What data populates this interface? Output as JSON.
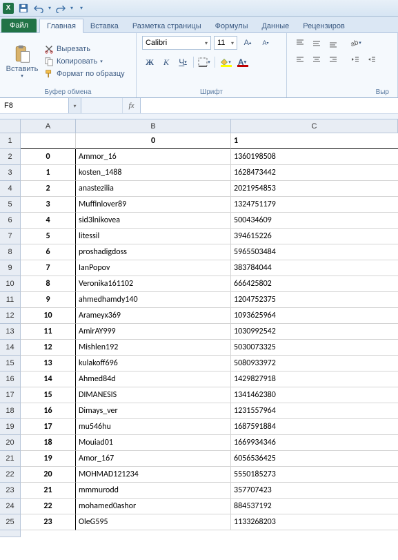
{
  "qat": {
    "save": "save",
    "undo": "undo",
    "redo": "redo"
  },
  "tabs": {
    "file": "Файл",
    "home": "Главная",
    "insert": "Вставка",
    "layout": "Разметка страницы",
    "formulas": "Формулы",
    "data": "Данные",
    "review": "Рецензиров"
  },
  "ribbon": {
    "paste": "Вставить",
    "cut": "Вырезать",
    "copy": "Копировать",
    "fmtpainter": "Формат по образцу",
    "clipboard_label": "Буфер обмена",
    "font_name": "Calibri",
    "font_size": "11",
    "font_label": "Шрифт",
    "align_label": "Выр"
  },
  "namebox": "F8",
  "formula": "",
  "columns": [
    "A",
    "B",
    "C"
  ],
  "header_row": [
    "",
    "0",
    "1"
  ],
  "rows": [
    {
      "n": 1
    },
    {
      "n": 2,
      "a": "0",
      "b": "Ammor_16",
      "c": "1360198508"
    },
    {
      "n": 3,
      "a": "1",
      "b": "kosten_1488",
      "c": "1628473442"
    },
    {
      "n": 4,
      "a": "2",
      "b": "anastezilia",
      "c": "2021954853"
    },
    {
      "n": 5,
      "a": "3",
      "b": "Muffinlover89",
      "c": "1324751179"
    },
    {
      "n": 6,
      "a": "4",
      "b": "sid3lnikovea",
      "c": "500434609"
    },
    {
      "n": 7,
      "a": "5",
      "b": "litessil",
      "c": "394615226"
    },
    {
      "n": 8,
      "a": "6",
      "b": "proshadigdoss",
      "c": "5965503484"
    },
    {
      "n": 9,
      "a": "7",
      "b": "IanPopov",
      "c": "383784044"
    },
    {
      "n": 10,
      "a": "8",
      "b": "Veronika161102",
      "c": "666425802"
    },
    {
      "n": 11,
      "a": "9",
      "b": "ahmedhamdy140",
      "c": "1204752375"
    },
    {
      "n": 12,
      "a": "10",
      "b": "Arameyx369",
      "c": "1093625964"
    },
    {
      "n": 13,
      "a": "11",
      "b": "AmirAY999",
      "c": "1030992542"
    },
    {
      "n": 14,
      "a": "12",
      "b": "Mishlen192",
      "c": "5030073325"
    },
    {
      "n": 15,
      "a": "13",
      "b": "kulakoff696",
      "c": "5080933972"
    },
    {
      "n": 16,
      "a": "14",
      "b": "Ahmed84d",
      "c": "1429827918"
    },
    {
      "n": 17,
      "a": "15",
      "b": "DIMANESIS",
      "c": "1341462380"
    },
    {
      "n": 18,
      "a": "16",
      "b": "Dimays_ver",
      "c": "1231557964"
    },
    {
      "n": 19,
      "a": "17",
      "b": "mu546hu",
      "c": "1687591884"
    },
    {
      "n": 20,
      "a": "18",
      "b": "Mouiad01",
      "c": "1669934346"
    },
    {
      "n": 21,
      "a": "19",
      "b": "Amor_167",
      "c": "6056536425"
    },
    {
      "n": 22,
      "a": "20",
      "b": "MOHMAD121234",
      "c": "5550185273"
    },
    {
      "n": 23,
      "a": "21",
      "b": "mmmurodd",
      "c": "357707423"
    },
    {
      "n": 24,
      "a": "22",
      "b": "mohamed0ashor",
      "c": "884537192"
    },
    {
      "n": 25,
      "a": "23",
      "b": "OleG595",
      "c": "1133268203"
    }
  ]
}
